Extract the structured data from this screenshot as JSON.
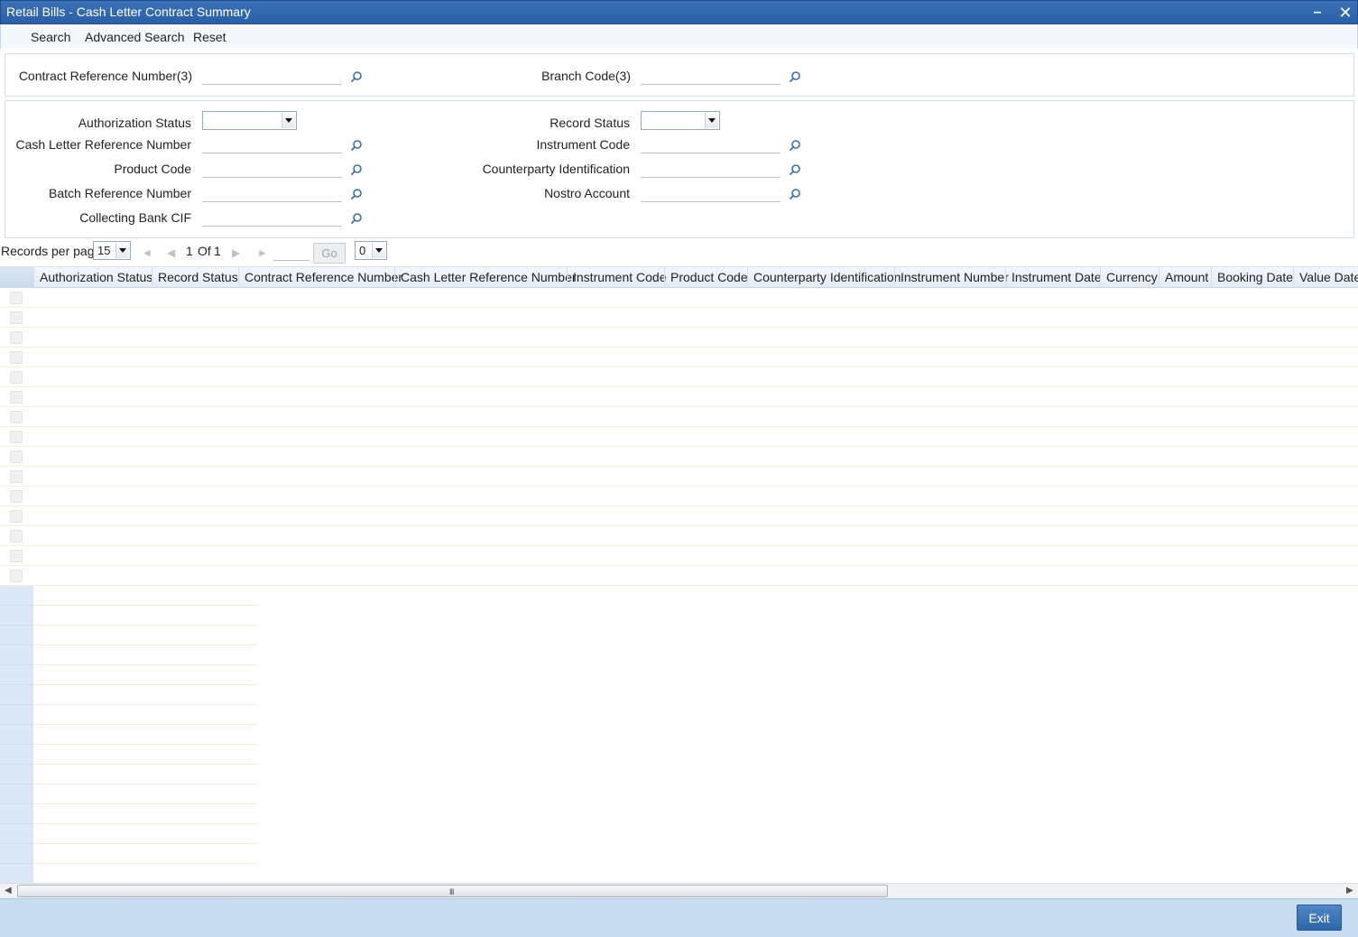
{
  "window": {
    "title": "Retail Bills - Cash Letter Contract Summary",
    "minimize_glyph": "–",
    "close_glyph": "✕"
  },
  "menu": {
    "search": "Search",
    "advanced_search": "Advanced Search",
    "reset": "Reset"
  },
  "panel1": {
    "contract_ref_label": "Contract Reference Number(3)",
    "branch_code_label": "Branch Code(3)"
  },
  "panel2": {
    "authorization_status_label": "Authorization Status",
    "record_status_label": "Record Status",
    "cash_letter_ref_label": "Cash Letter Reference Number",
    "instrument_code_label": "Instrument Code",
    "product_code_label": "Product Code",
    "counterparty_id_label": "Counterparty Identification",
    "batch_ref_label": "Batch Reference Number",
    "nostro_account_label": "Nostro Account",
    "collecting_bank_cif_label": "Collecting Bank CIF"
  },
  "pager": {
    "records_per_page_label": "Records per page",
    "records_per_page_value": "15",
    "page_current": "1",
    "page_of": "Of",
    "page_total": "1",
    "go_label": "Go",
    "extra_select_value": "0"
  },
  "grid": {
    "columns": [
      "Authorization Status",
      "Record Status",
      "Contract Reference Number",
      "Cash Letter Reference Number",
      "Instrument Code",
      "Product Code",
      "Counterparty Identification",
      "Instrument Number",
      "Instrument Date",
      "Currency",
      "Amount",
      "Booking Date",
      "Value Date"
    ],
    "row_count": 15,
    "empty_row_count": 15
  },
  "scrollbar": {
    "grip": "III"
  },
  "footer": {
    "exit_label": "Exit"
  },
  "colors": {
    "title_bar": "#2f64aa",
    "footer": "#c7dcef",
    "exit_button": "#3d75b8"
  }
}
